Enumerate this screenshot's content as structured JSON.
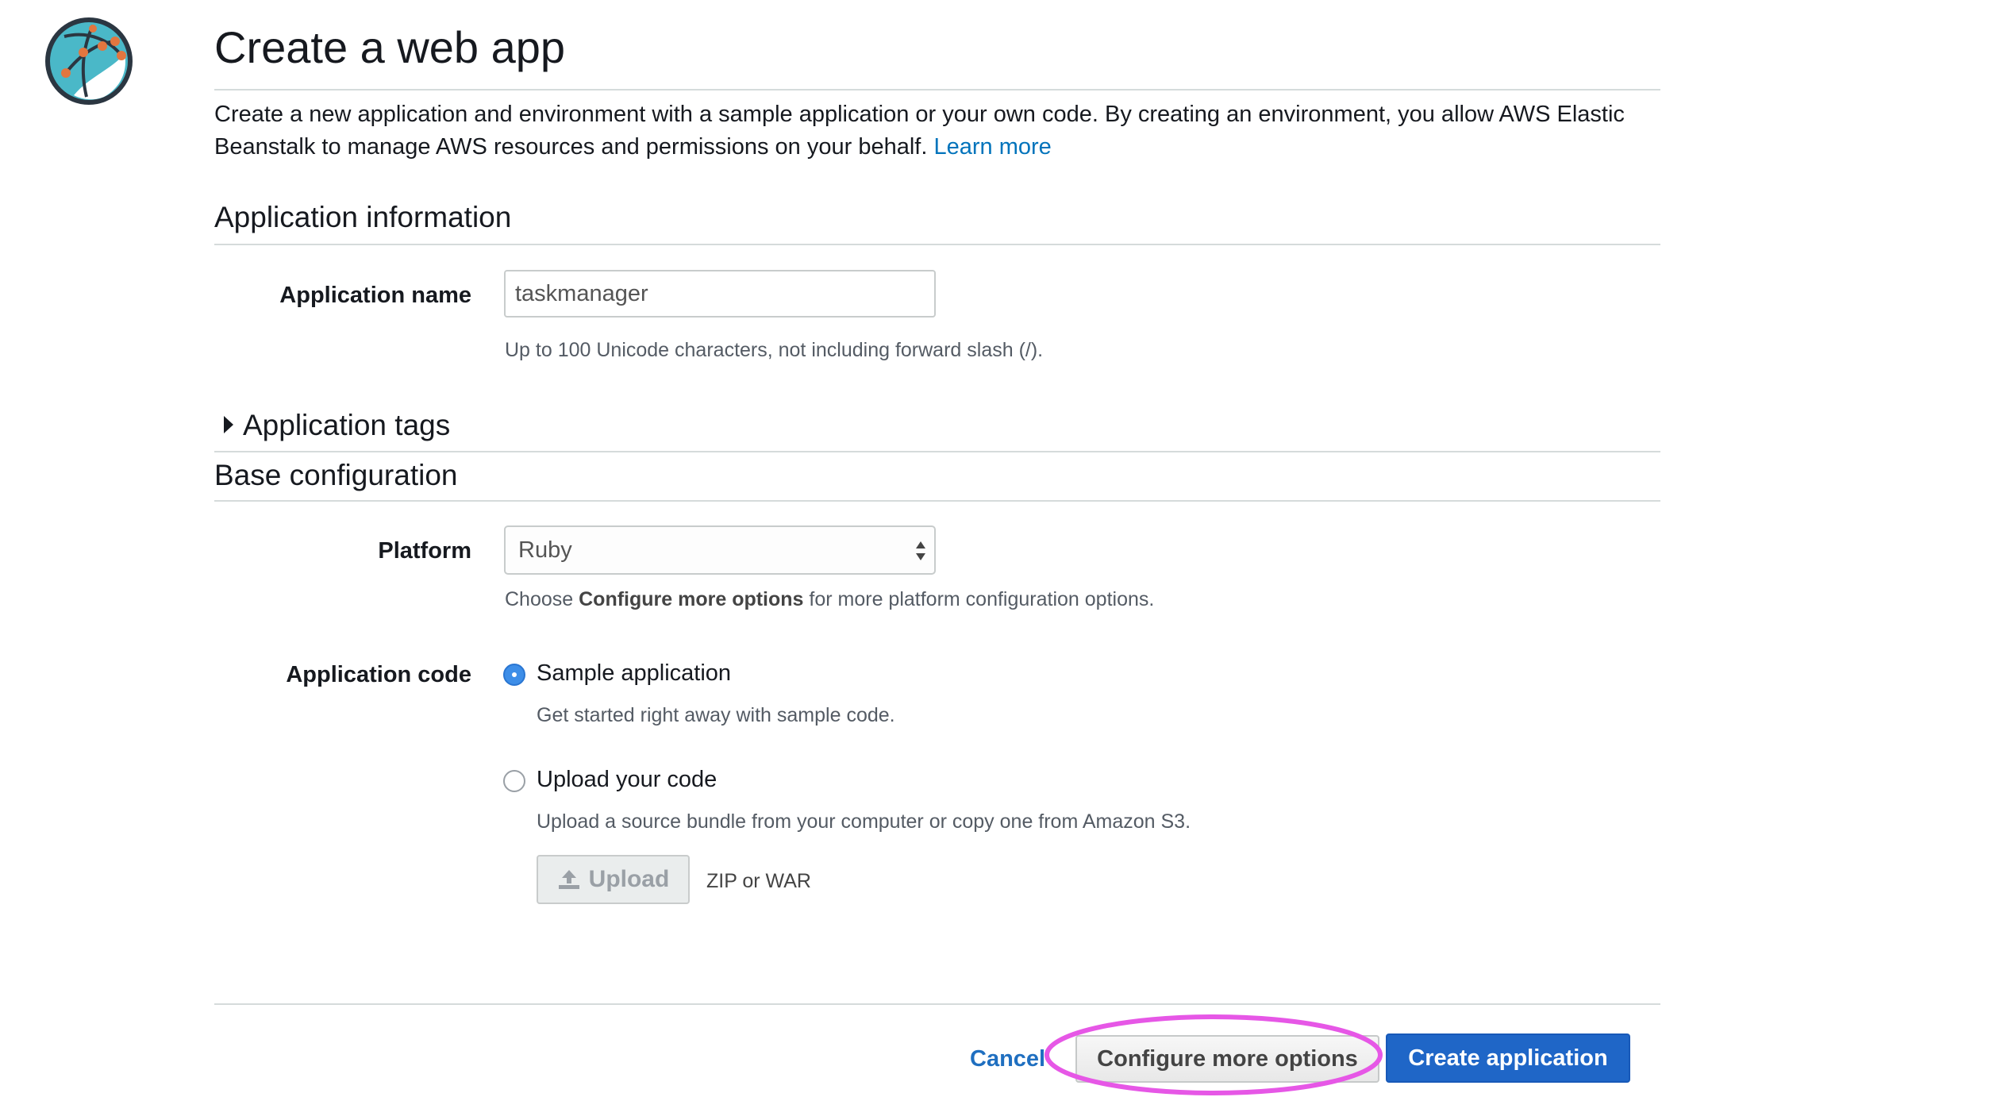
{
  "page": {
    "title": "Create a web app",
    "intro_text": "Create a new application and environment with a sample application or your own code. By creating an environment, you allow AWS Elastic Beanstalk to manage AWS resources and permissions on your behalf.",
    "learn_more": "Learn more"
  },
  "app_info": {
    "heading": "Application information",
    "name_label": "Application name",
    "name_value": "taskmanager",
    "name_hint": "Up to 100 Unicode characters, not including forward slash (/).",
    "tags_label": "Application tags"
  },
  "base_config": {
    "heading": "Base configuration",
    "platform_label": "Platform",
    "platform_value": "Ruby",
    "platform_hint_prefix": "Choose ",
    "platform_hint_bold": "Configure more options",
    "platform_hint_suffix": " for more platform configuration options.",
    "code_label": "Application code",
    "options": [
      {
        "label": "Sample application",
        "description": "Get started right away with sample code.",
        "selected": true
      },
      {
        "label": "Upload your code",
        "description": "Upload a source bundle from your computer or copy one from Amazon S3.",
        "selected": false
      }
    ],
    "upload_button": "Upload",
    "upload_hint": "ZIP or WAR"
  },
  "footer": {
    "cancel": "Cancel",
    "configure_more": "Configure more options",
    "create": "Create application"
  },
  "colors": {
    "link": "#0073bb",
    "primary": "#1f66c7",
    "radio_selected": "#3d8ee8",
    "annotation": "#e657e6"
  },
  "icons": {
    "logo": "elastic-beanstalk-globe-icon",
    "upload": "upload-icon",
    "disclosure": "triangle-right-icon",
    "select": "select-arrows-icon"
  }
}
